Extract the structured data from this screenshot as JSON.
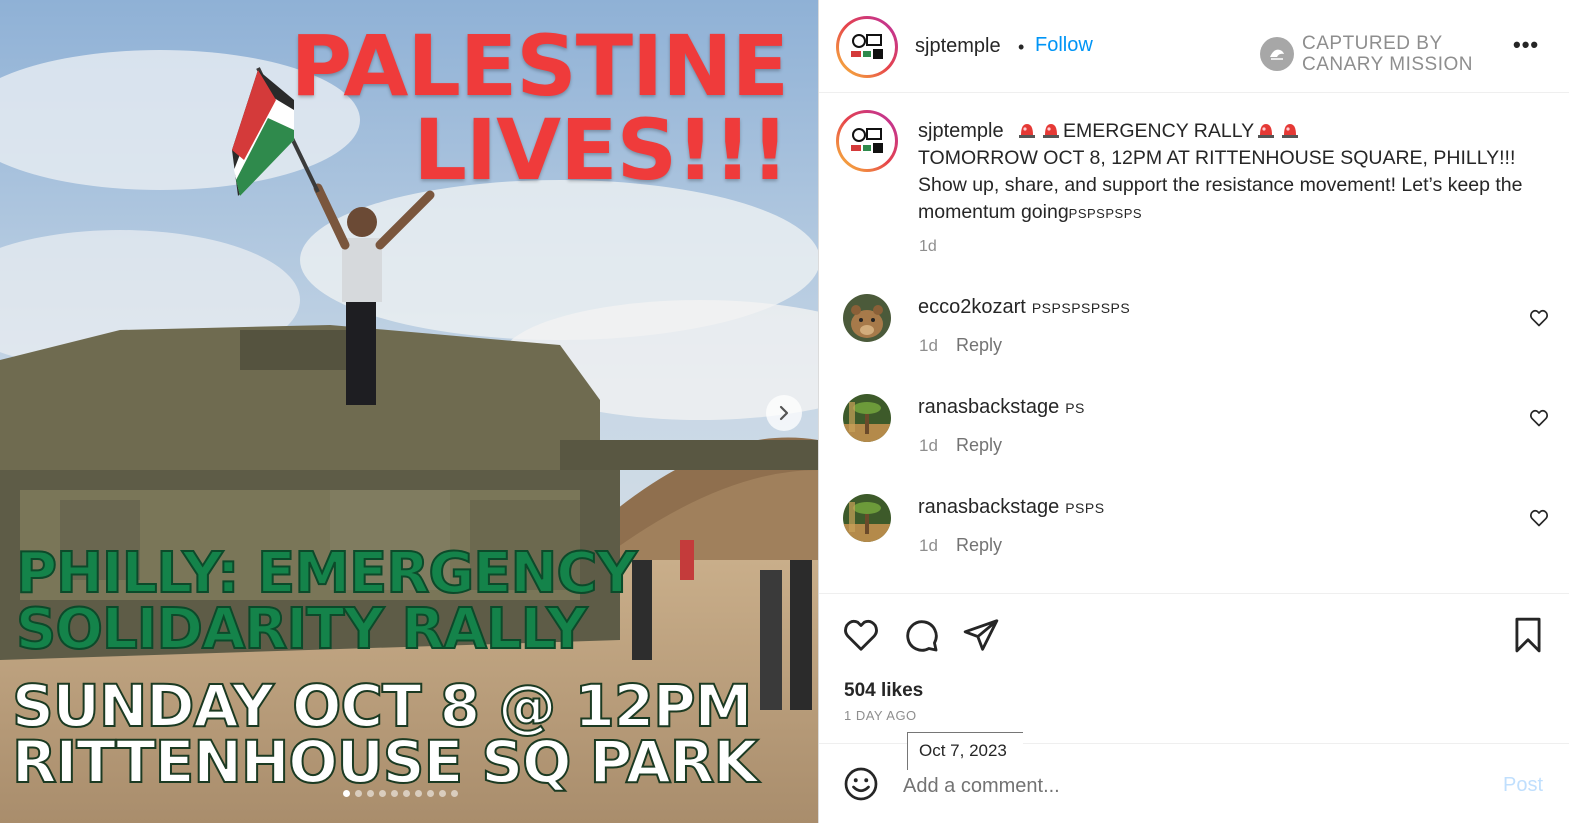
{
  "post_image": {
    "headline_lines": [
      "PALESTINE",
      "LIVES!!!"
    ],
    "rally_lines": [
      "PHILLY: EMERGENCY",
      "SOLIDARITY RALLY"
    ],
    "when_lines": [
      "SUNDAY OCT 8 @ 12PM",
      "RITTENHOUSE SQ PARK"
    ],
    "carousel": {
      "total": 10,
      "current": 1
    },
    "colors": {
      "headline": "#ef3b3b",
      "rally": "#14834a",
      "when": "#ffffff"
    }
  },
  "header": {
    "username": "sjptemple",
    "separator": "•",
    "follow_label": "Follow",
    "captured_line1": "CAPTURED BY",
    "captured_line2": "CANARY MISSION",
    "more_label": "•••"
  },
  "caption": {
    "username": "sjptemple",
    "title": "EMERGENCY RALLY",
    "line2": "TOMORROW OCT 8, 12PM AT RITTENHOUSE SQUARE, PHILLY!!!",
    "line3": "Show up, share, and support the resistance movement! Let’s keep the momentum going",
    "trailing": "PSPSPSPS",
    "time": "1d"
  },
  "comments": [
    {
      "username": "ecco2kozart",
      "text": "PSPSPSPSPS",
      "time": "1d",
      "reply_label": "Reply"
    },
    {
      "username": "ranasbackstage",
      "text": "PS",
      "time": "1d",
      "reply_label": "Reply"
    },
    {
      "username": "ranasbackstage",
      "text": "PSPS",
      "time": "1d",
      "reply_label": "Reply"
    }
  ],
  "stats": {
    "likes": "504 likes",
    "ago": "1 DAY AGO",
    "tooltip_date": "Oct 7, 2023"
  },
  "compose": {
    "placeholder": "Add a comment...",
    "post_label": "Post"
  },
  "icons": [
    "next-arrow-icon",
    "heart-icon",
    "comment-icon",
    "share-icon",
    "bookmark-icon",
    "emoji-icon",
    "canary-icon",
    "siren-icon"
  ],
  "colors": {
    "link": "#0095f6",
    "muted": "#8e8e8e",
    "text": "#262626",
    "post_disabled": "#c0dffd"
  }
}
